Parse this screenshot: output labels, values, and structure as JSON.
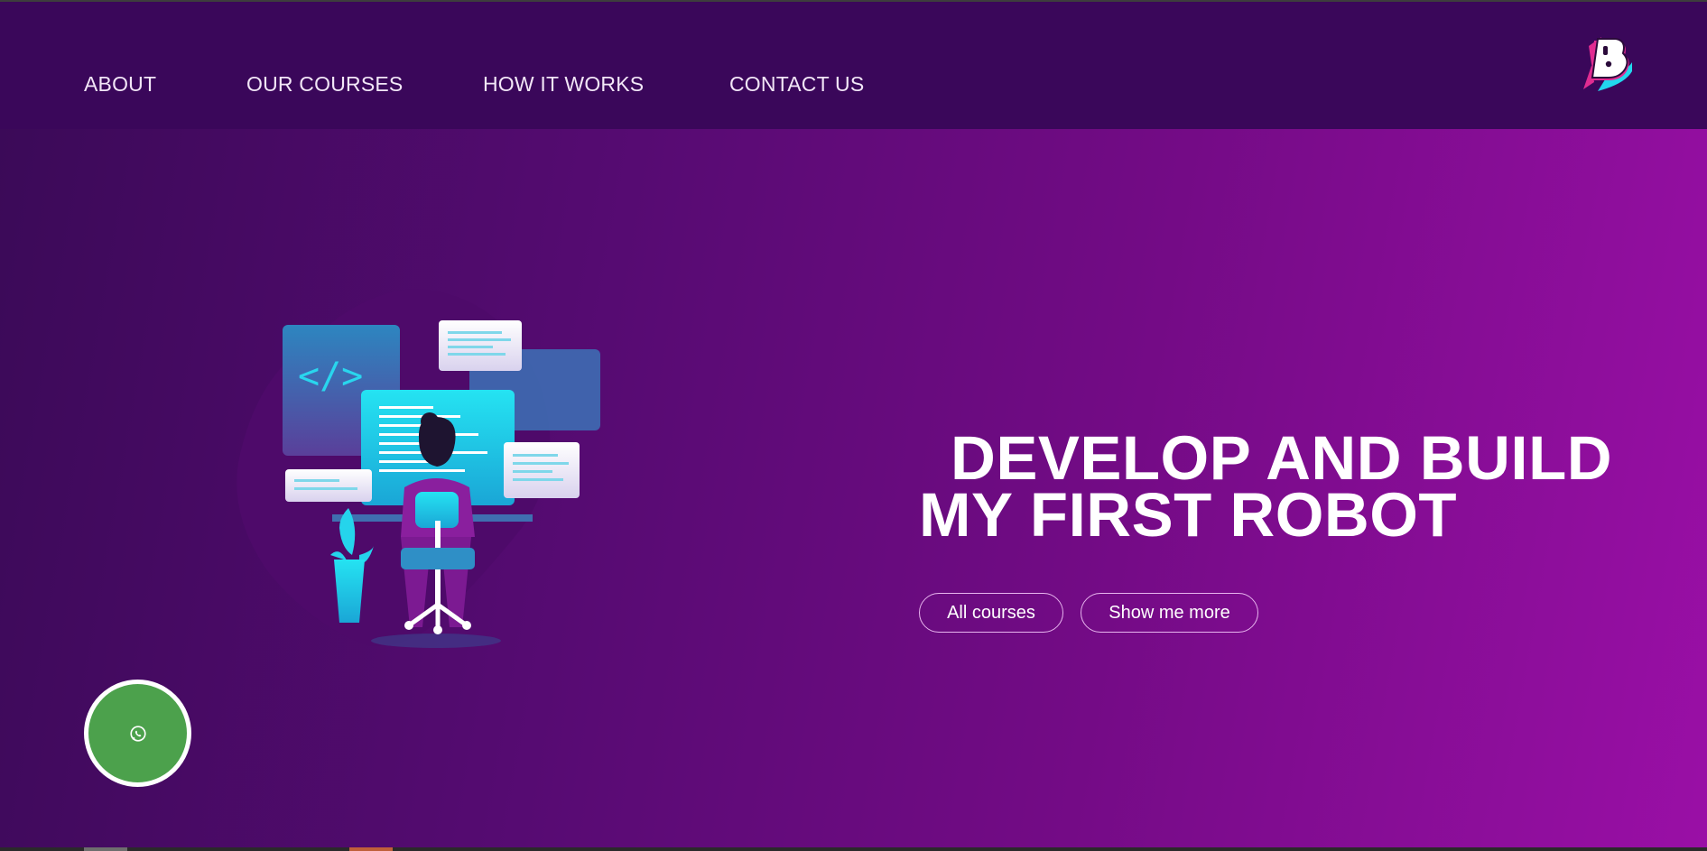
{
  "nav": {
    "items": [
      {
        "label": "ABOUT"
      },
      {
        "label": "OUR COURSES"
      },
      {
        "label": "HOW IT WORKS"
      },
      {
        "label": "CONTACT US"
      }
    ],
    "logo_icon": "brand-b-logo"
  },
  "hero": {
    "headline_line1": "DEVELOP AND BUILD",
    "headline_line2": "MY FIRST ROBOT",
    "buttons": {
      "all_courses": "All courses",
      "show_more": "Show me more"
    },
    "illustration_icon": "developer-at-desk-illustration",
    "code_symbol": "</>"
  },
  "floating": {
    "whatsapp_icon": "whatsapp-icon"
  },
  "colors": {
    "nav_bg": "#3a075a",
    "hero_gradient_start": "#3b0a58",
    "hero_gradient_end": "#9a0fa6",
    "accent_cyan": "#22d8ee",
    "whatsapp_green": "#4ca14c",
    "text": "#ffffff"
  }
}
